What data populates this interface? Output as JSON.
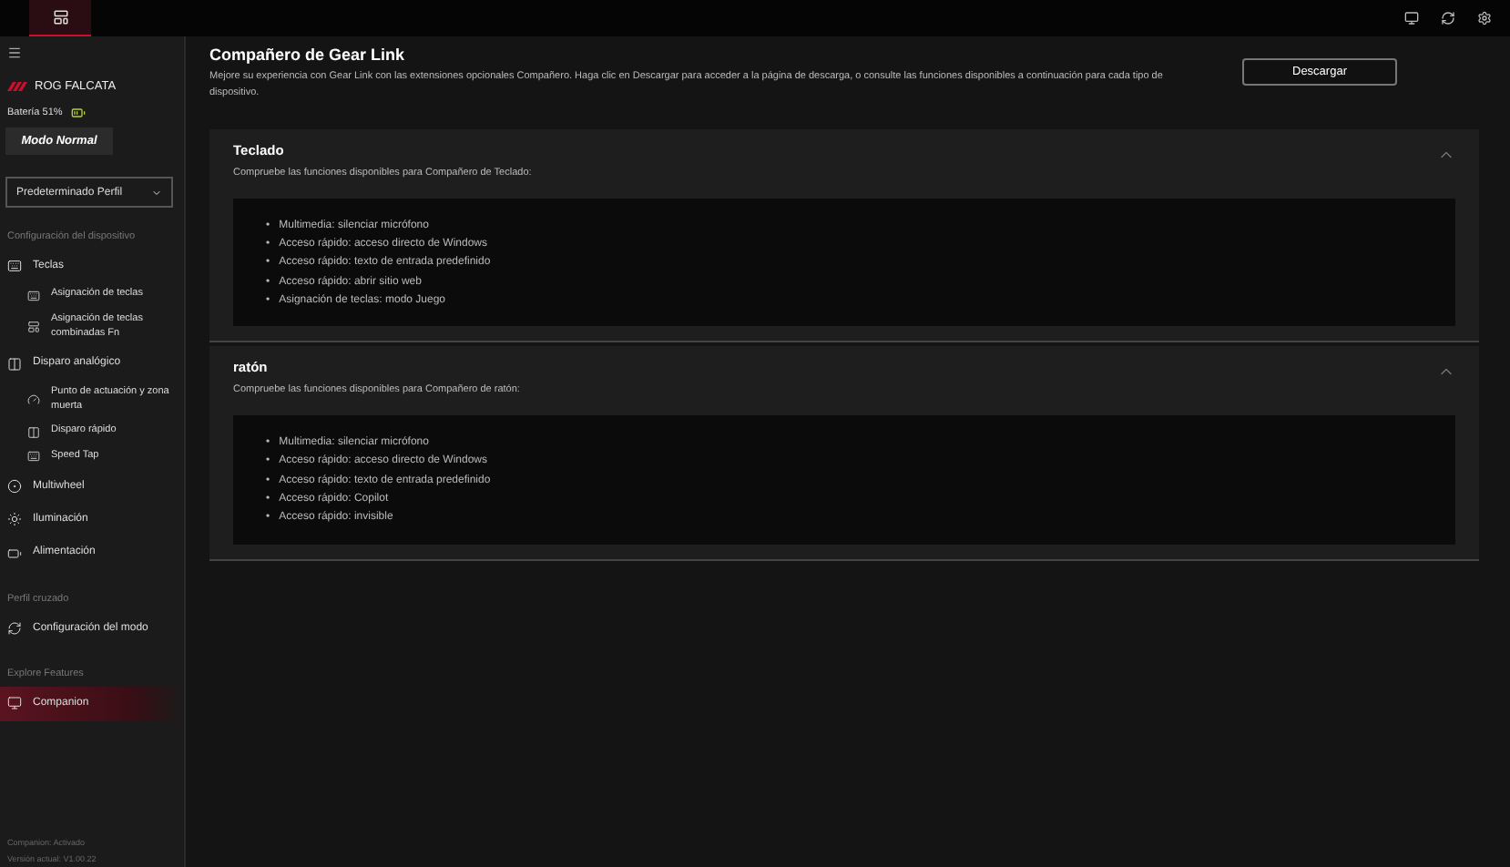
{
  "sidebar": {
    "device": "ROG FALCATA",
    "battery": "Batería 51%",
    "mode_button": "Modo Normal",
    "profile_select": "Predeterminado Perfil",
    "sections": [
      {
        "heading": "Configuración del dispositivo",
        "items": [
          {
            "label": "Teclas",
            "selected": false,
            "children": [
              {
                "label": "Asignación de teclas",
                "selected": false
              },
              {
                "label": "Asignación de teclas combinadas Fn",
                "selected": false
              }
            ]
          },
          {
            "label": "Disparo analógico",
            "selected": false,
            "children": [
              {
                "label": "Punto de actuación y zona muerta",
                "selected": false
              },
              {
                "label": "Disparo rápido",
                "selected": false
              },
              {
                "label": "Speed Tap",
                "selected": false
              }
            ]
          },
          {
            "label": "Multiwheel",
            "selected": false
          },
          {
            "label": "Iluminación",
            "selected": false
          },
          {
            "label": "Alimentación",
            "selected": false
          }
        ]
      },
      {
        "heading": "Perfil cruzado",
        "items": [
          {
            "label": "Configuración del modo",
            "selected": false
          }
        ]
      },
      {
        "heading": "Explore Features",
        "items": [
          {
            "label": "Companion",
            "selected": true
          }
        ]
      }
    ],
    "footer": [
      "Companion: Activado",
      "Versión actual: V1.00.22"
    ]
  },
  "main": {
    "title": "Compañero de Gear Link",
    "description": "Mejore su experiencia con Gear Link con las extensiones opcionales Compañero. Haga clic en Descargar para acceder a la página de descarga, o consulte las funciones disponibles a continuación para cada tipo de dispositivo.",
    "download_button": "Descargar",
    "cards": [
      {
        "title": "Teclado",
        "subtitle": "Compruebe las funciones disponibles para Compañero de Teclado:",
        "expanded": true,
        "features": [
          {
            "bullet": "•",
            "text": "Multimedia: silenciar micrófono"
          },
          {
            "bullet": "•",
            "text": "Acceso rápido: acceso directo de Windows"
          },
          {
            "bullet": "•",
            "text": "Acceso rápido: texto de entrada predefinido"
          },
          {
            "bullet": "•",
            "text": "Acceso rápido: abrir sitio web"
          },
          {
            "bullet": "•",
            "text": "Asignación de teclas: modo Juego"
          }
        ]
      },
      {
        "title": "ratón",
        "subtitle": "Compruebe las funciones disponibles para Compañero de ratón:",
        "expanded": true,
        "features": [
          {
            "bullet": "•",
            "text": "Multimedia: silenciar micrófono"
          },
          {
            "bullet": "•",
            "text": "Acceso rápido: acceso directo de Windows"
          },
          {
            "bullet": "•",
            "text": "Acceso rápido: texto de entrada predefinido"
          },
          {
            "bullet": "•",
            "text": "Acceso rápido: Copilot"
          },
          {
            "bullet": "•",
            "text": "Acceso rápido: invisible"
          }
        ]
      }
    ]
  }
}
